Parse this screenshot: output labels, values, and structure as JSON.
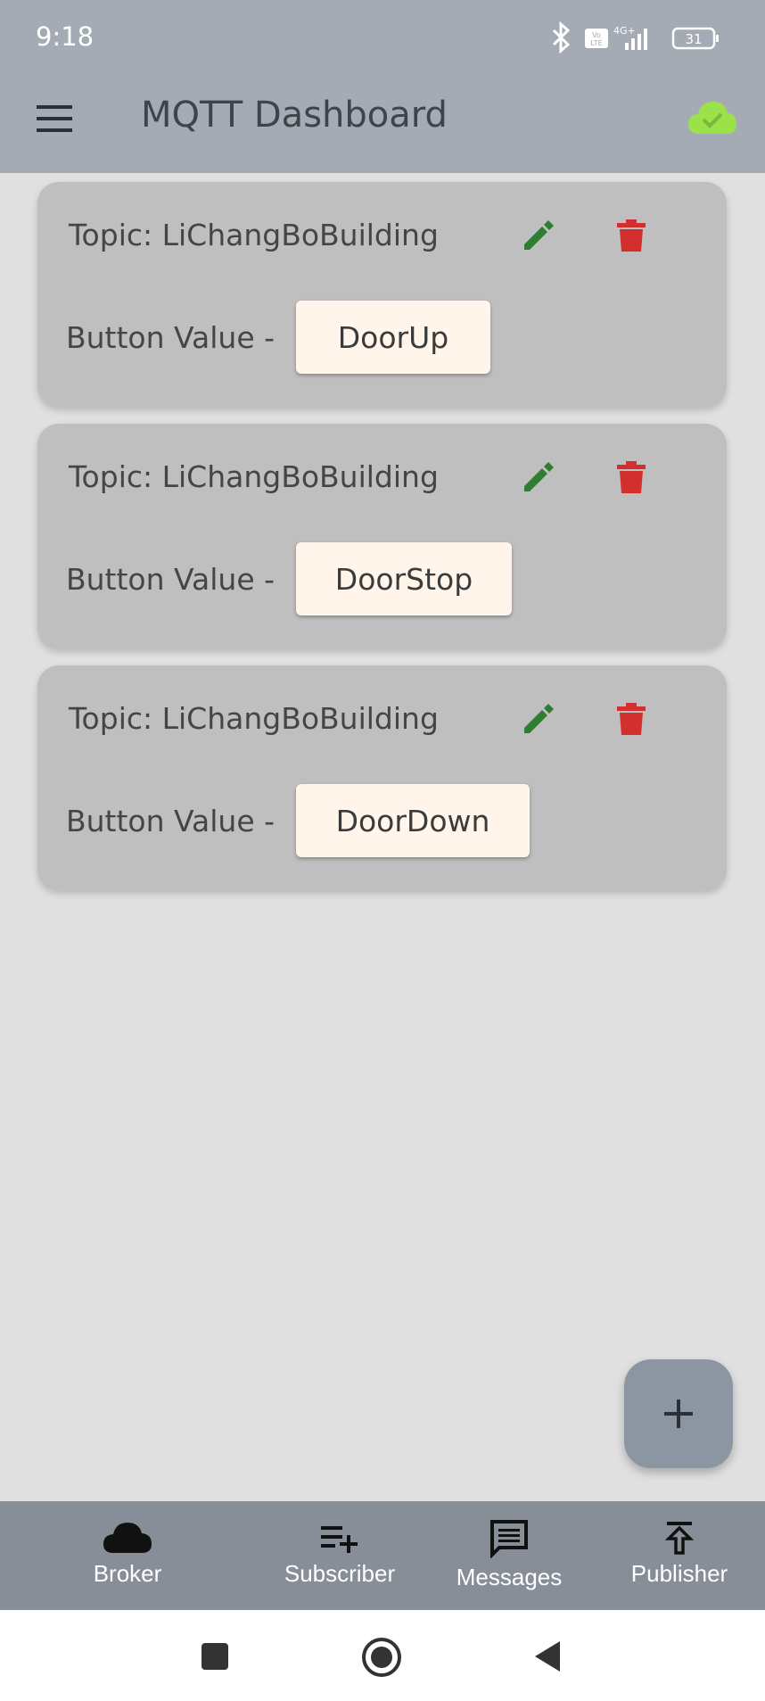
{
  "status_bar": {
    "time": "9:18",
    "icons": [
      "bluetooth-icon",
      "volte-icon",
      "4g-signal-icon",
      "battery-icon"
    ],
    "battery": "31"
  },
  "app_bar": {
    "title": "MQTT Dashboard",
    "connection_icon": "cloud-check-icon",
    "connection_color": "#9be24a"
  },
  "cards": [
    {
      "topic": "Topic: LiChangBoBuilding",
      "button_value_label": "Button Value -",
      "button_value": "DoorUp"
    },
    {
      "topic": "Topic: LiChangBoBuilding",
      "button_value_label": "Button Value -",
      "button_value": "DoorStop"
    },
    {
      "topic": "Topic: LiChangBoBuilding",
      "button_value_label": "Button Value -",
      "button_value": "DoorDown"
    }
  ],
  "colors": {
    "edit": "#2e7d32",
    "delete": "#d32f2f",
    "app_bar": "#a4abb4",
    "bottom_nav": "#878e98",
    "card": "#bfbfbf",
    "value_button": "#fff5ea"
  },
  "fab": {
    "icon": "plus-icon"
  },
  "bottom_nav": {
    "items": [
      {
        "label": "Broker",
        "icon": "cloud-icon"
      },
      {
        "label": "Subscriber",
        "icon": "playlist-add-icon"
      },
      {
        "label": "Messages",
        "icon": "message-icon"
      },
      {
        "label": "Publisher",
        "icon": "publish-icon"
      }
    ]
  },
  "system_nav": {
    "icons": [
      "recents-icon",
      "home-icon",
      "back-icon"
    ]
  }
}
